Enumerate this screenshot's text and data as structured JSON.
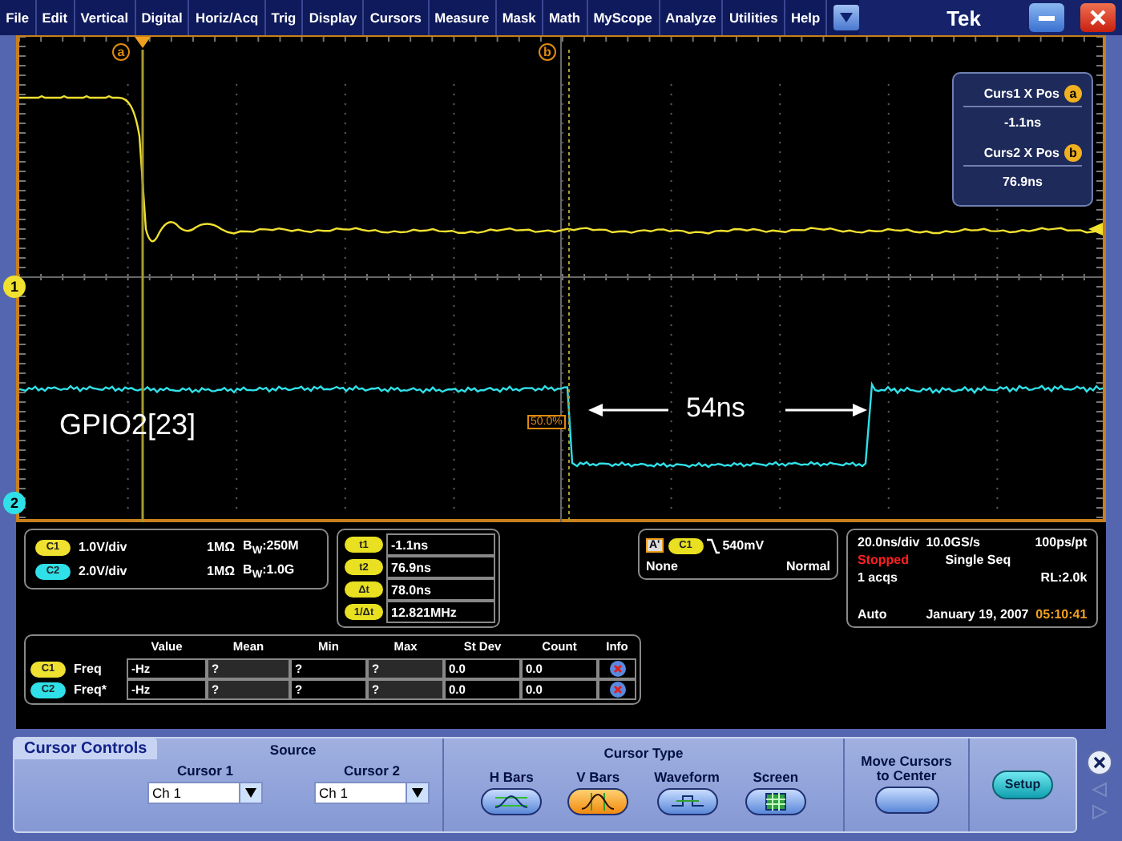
{
  "menu": [
    "File",
    "Edit",
    "Vertical",
    "Digital",
    "Horiz/Acq",
    "Trig",
    "Display",
    "Cursors",
    "Measure",
    "Mask",
    "Math",
    "MyScope",
    "Analyze",
    "Utilities",
    "Help"
  ],
  "brand": "Tek",
  "waveform": {
    "label": "GPIO2[23]",
    "measure_label": "54ns",
    "threshold_label": "50.0%",
    "cursor_markers": [
      "a",
      "b"
    ],
    "channel_markers": [
      "1",
      "2"
    ]
  },
  "cursor_readout": [
    {
      "label": "Curs1 X Pos",
      "marker": "a",
      "value": "-1.1ns"
    },
    {
      "label": "Curs2 X Pos",
      "marker": "b",
      "value": "76.9ns"
    }
  ],
  "channels": [
    {
      "badge": "C1",
      "color": "#f0e030",
      "scale": "1.0V/div",
      "impedance": "1MΩ",
      "bandwidth": "B$_{W}$:250M"
    },
    {
      "badge": "C2",
      "color": "#30e0e8",
      "scale": "2.0V/div",
      "impedance": "1MΩ",
      "bandwidth": "B$_{W}$:1.0G"
    }
  ],
  "cursor_values": [
    {
      "badge": "t1",
      "value": "-1.1ns"
    },
    {
      "badge": "t2",
      "value": "76.9ns"
    },
    {
      "badge": "Δt",
      "value": "78.0ns"
    },
    {
      "badge": "1/Δt",
      "value": "12.821MHz"
    }
  ],
  "trigger": {
    "source_tag": "A'",
    "channel": "C1",
    "level": "540mV",
    "coupling": "None",
    "mode": "Normal"
  },
  "acquisition": {
    "timebase": "20.0ns/div",
    "sample_rate": "10.0GS/s",
    "resolution": "100ps/pt",
    "status": "Stopped",
    "mode": "Single Seq",
    "acqs": "1 acqs",
    "record_length": "RL:2.0k",
    "trigger_mode": "Auto",
    "date": "January 19, 2007",
    "time": "05:10:41"
  },
  "measurements": {
    "columns": [
      "Value",
      "Mean",
      "Min",
      "Max",
      "St Dev",
      "Count",
      "Info"
    ],
    "rows": [
      {
        "badge": "C1",
        "color": "#f0e030",
        "name": "Freq",
        "cells": [
          "-Hz",
          "?",
          "?",
          "?",
          "0.0",
          "0.0"
        ]
      },
      {
        "badge": "C2",
        "color": "#30e0e8",
        "name": "Freq*",
        "cells": [
          "-Hz",
          "?",
          "?",
          "?",
          "0.0",
          "0.0"
        ]
      }
    ]
  },
  "cursor_controls": {
    "title": "Cursor Controls",
    "source_label": "Source",
    "sources": [
      {
        "label": "Cursor 1",
        "value": "Ch 1"
      },
      {
        "label": "Cursor 2",
        "value": "Ch 1"
      }
    ],
    "type_label": "Cursor Type",
    "types": [
      {
        "kind": "hbars",
        "label": "H Bars",
        "selected": false
      },
      {
        "kind": "vbars",
        "label": "V Bars",
        "selected": true
      },
      {
        "kind": "waveform",
        "label": "Waveform",
        "selected": false
      },
      {
        "kind": "screen",
        "label": "Screen",
        "selected": false
      }
    ],
    "move_label": "Move Cursors to Center",
    "setup": "Setup"
  }
}
